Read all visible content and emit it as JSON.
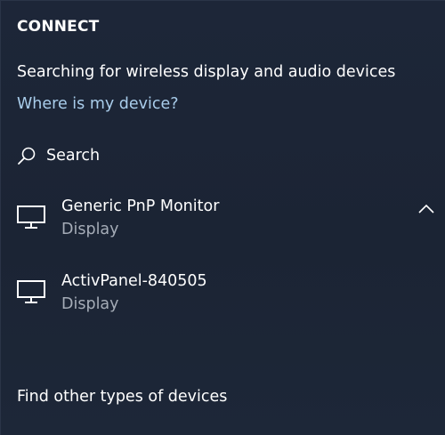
{
  "header": {
    "title": "CONNECT"
  },
  "status": {
    "text": "Searching for wireless display and audio devices"
  },
  "help": {
    "link_text": "Where is my device?"
  },
  "search": {
    "label": "Search",
    "icon": "search-icon"
  },
  "devices": [
    {
      "name": "Generic PnP Monitor",
      "type": "Display",
      "icon": "monitor-icon",
      "expanded": true
    },
    {
      "name": "ActivPanel-840505",
      "type": "Display",
      "icon": "monitor-icon",
      "expanded": false
    }
  ],
  "footer": {
    "find_other": "Find other types of devices"
  },
  "colors": {
    "background": "#1c2637",
    "link": "#a9cdeb",
    "secondary_text": "#a5acb7",
    "primary_text": "#ffffff"
  }
}
